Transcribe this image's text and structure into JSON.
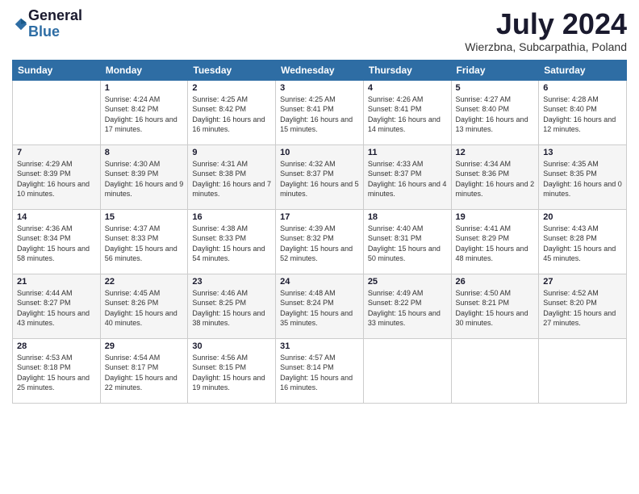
{
  "logo": {
    "general": "General",
    "blue": "Blue"
  },
  "header": {
    "title": "July 2024",
    "subtitle": "Wierzbna, Subcarpathia, Poland"
  },
  "weekdays": [
    "Sunday",
    "Monday",
    "Tuesday",
    "Wednesday",
    "Thursday",
    "Friday",
    "Saturday"
  ],
  "weeks": [
    [
      {
        "day": "",
        "sunrise": "",
        "sunset": "",
        "daylight": ""
      },
      {
        "day": "1",
        "sunrise": "Sunrise: 4:24 AM",
        "sunset": "Sunset: 8:42 PM",
        "daylight": "Daylight: 16 hours and 17 minutes."
      },
      {
        "day": "2",
        "sunrise": "Sunrise: 4:25 AM",
        "sunset": "Sunset: 8:42 PM",
        "daylight": "Daylight: 16 hours and 16 minutes."
      },
      {
        "day": "3",
        "sunrise": "Sunrise: 4:25 AM",
        "sunset": "Sunset: 8:41 PM",
        "daylight": "Daylight: 16 hours and 15 minutes."
      },
      {
        "day": "4",
        "sunrise": "Sunrise: 4:26 AM",
        "sunset": "Sunset: 8:41 PM",
        "daylight": "Daylight: 16 hours and 14 minutes."
      },
      {
        "day": "5",
        "sunrise": "Sunrise: 4:27 AM",
        "sunset": "Sunset: 8:40 PM",
        "daylight": "Daylight: 16 hours and 13 minutes."
      },
      {
        "day": "6",
        "sunrise": "Sunrise: 4:28 AM",
        "sunset": "Sunset: 8:40 PM",
        "daylight": "Daylight: 16 hours and 12 minutes."
      }
    ],
    [
      {
        "day": "7",
        "sunrise": "Sunrise: 4:29 AM",
        "sunset": "Sunset: 8:39 PM",
        "daylight": "Daylight: 16 hours and 10 minutes."
      },
      {
        "day": "8",
        "sunrise": "Sunrise: 4:30 AM",
        "sunset": "Sunset: 8:39 PM",
        "daylight": "Daylight: 16 hours and 9 minutes."
      },
      {
        "day": "9",
        "sunrise": "Sunrise: 4:31 AM",
        "sunset": "Sunset: 8:38 PM",
        "daylight": "Daylight: 16 hours and 7 minutes."
      },
      {
        "day": "10",
        "sunrise": "Sunrise: 4:32 AM",
        "sunset": "Sunset: 8:37 PM",
        "daylight": "Daylight: 16 hours and 5 minutes."
      },
      {
        "day": "11",
        "sunrise": "Sunrise: 4:33 AM",
        "sunset": "Sunset: 8:37 PM",
        "daylight": "Daylight: 16 hours and 4 minutes."
      },
      {
        "day": "12",
        "sunrise": "Sunrise: 4:34 AM",
        "sunset": "Sunset: 8:36 PM",
        "daylight": "Daylight: 16 hours and 2 minutes."
      },
      {
        "day": "13",
        "sunrise": "Sunrise: 4:35 AM",
        "sunset": "Sunset: 8:35 PM",
        "daylight": "Daylight: 16 hours and 0 minutes."
      }
    ],
    [
      {
        "day": "14",
        "sunrise": "Sunrise: 4:36 AM",
        "sunset": "Sunset: 8:34 PM",
        "daylight": "Daylight: 15 hours and 58 minutes."
      },
      {
        "day": "15",
        "sunrise": "Sunrise: 4:37 AM",
        "sunset": "Sunset: 8:33 PM",
        "daylight": "Daylight: 15 hours and 56 minutes."
      },
      {
        "day": "16",
        "sunrise": "Sunrise: 4:38 AM",
        "sunset": "Sunset: 8:33 PM",
        "daylight": "Daylight: 15 hours and 54 minutes."
      },
      {
        "day": "17",
        "sunrise": "Sunrise: 4:39 AM",
        "sunset": "Sunset: 8:32 PM",
        "daylight": "Daylight: 15 hours and 52 minutes."
      },
      {
        "day": "18",
        "sunrise": "Sunrise: 4:40 AM",
        "sunset": "Sunset: 8:31 PM",
        "daylight": "Daylight: 15 hours and 50 minutes."
      },
      {
        "day": "19",
        "sunrise": "Sunrise: 4:41 AM",
        "sunset": "Sunset: 8:29 PM",
        "daylight": "Daylight: 15 hours and 48 minutes."
      },
      {
        "day": "20",
        "sunrise": "Sunrise: 4:43 AM",
        "sunset": "Sunset: 8:28 PM",
        "daylight": "Daylight: 15 hours and 45 minutes."
      }
    ],
    [
      {
        "day": "21",
        "sunrise": "Sunrise: 4:44 AM",
        "sunset": "Sunset: 8:27 PM",
        "daylight": "Daylight: 15 hours and 43 minutes."
      },
      {
        "day": "22",
        "sunrise": "Sunrise: 4:45 AM",
        "sunset": "Sunset: 8:26 PM",
        "daylight": "Daylight: 15 hours and 40 minutes."
      },
      {
        "day": "23",
        "sunrise": "Sunrise: 4:46 AM",
        "sunset": "Sunset: 8:25 PM",
        "daylight": "Daylight: 15 hours and 38 minutes."
      },
      {
        "day": "24",
        "sunrise": "Sunrise: 4:48 AM",
        "sunset": "Sunset: 8:24 PM",
        "daylight": "Daylight: 15 hours and 35 minutes."
      },
      {
        "day": "25",
        "sunrise": "Sunrise: 4:49 AM",
        "sunset": "Sunset: 8:22 PM",
        "daylight": "Daylight: 15 hours and 33 minutes."
      },
      {
        "day": "26",
        "sunrise": "Sunrise: 4:50 AM",
        "sunset": "Sunset: 8:21 PM",
        "daylight": "Daylight: 15 hours and 30 minutes."
      },
      {
        "day": "27",
        "sunrise": "Sunrise: 4:52 AM",
        "sunset": "Sunset: 8:20 PM",
        "daylight": "Daylight: 15 hours and 27 minutes."
      }
    ],
    [
      {
        "day": "28",
        "sunrise": "Sunrise: 4:53 AM",
        "sunset": "Sunset: 8:18 PM",
        "daylight": "Daylight: 15 hours and 25 minutes."
      },
      {
        "day": "29",
        "sunrise": "Sunrise: 4:54 AM",
        "sunset": "Sunset: 8:17 PM",
        "daylight": "Daylight: 15 hours and 22 minutes."
      },
      {
        "day": "30",
        "sunrise": "Sunrise: 4:56 AM",
        "sunset": "Sunset: 8:15 PM",
        "daylight": "Daylight: 15 hours and 19 minutes."
      },
      {
        "day": "31",
        "sunrise": "Sunrise: 4:57 AM",
        "sunset": "Sunset: 8:14 PM",
        "daylight": "Daylight: 15 hours and 16 minutes."
      },
      {
        "day": "",
        "sunrise": "",
        "sunset": "",
        "daylight": ""
      },
      {
        "day": "",
        "sunrise": "",
        "sunset": "",
        "daylight": ""
      },
      {
        "day": "",
        "sunrise": "",
        "sunset": "",
        "daylight": ""
      }
    ]
  ]
}
